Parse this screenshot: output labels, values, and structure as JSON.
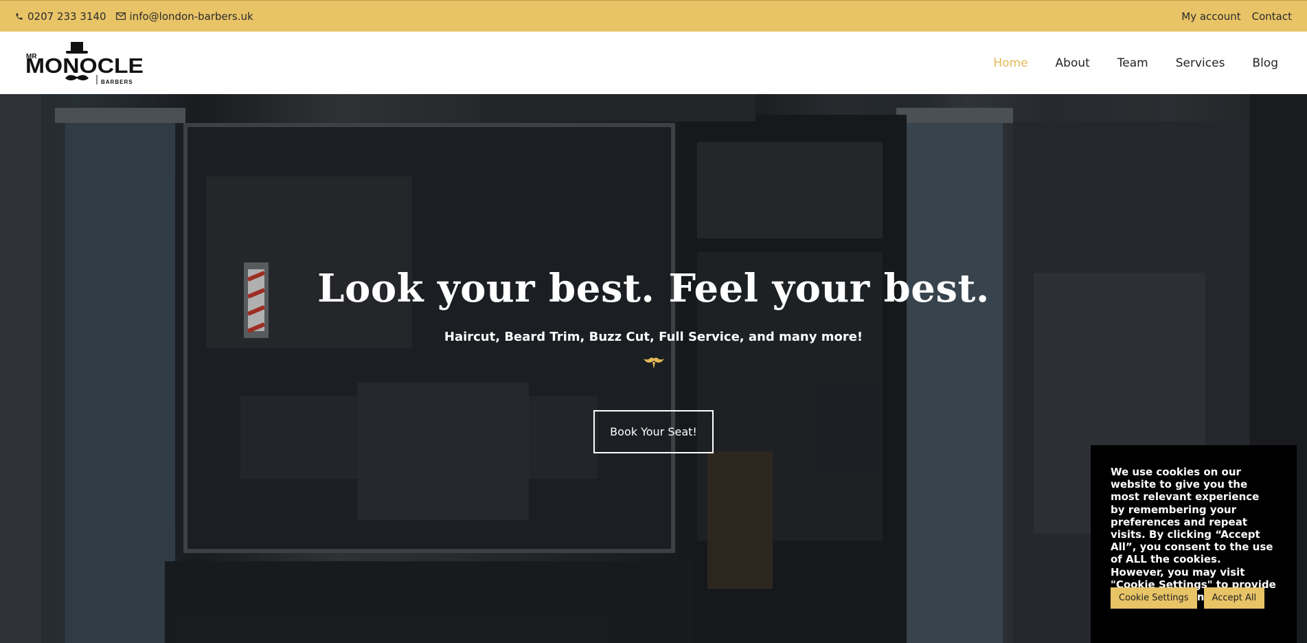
{
  "topbar": {
    "phone": "0207 233 3140",
    "email": "info@london-barbers.uk",
    "links": {
      "account": "My account",
      "contact": "Contact"
    },
    "background": "#e8c467"
  },
  "header": {
    "logo": {
      "line1": "MR",
      "line2": "MONOCLE",
      "line3": "BARBERS"
    },
    "nav": {
      "home": "Home",
      "about": "About",
      "team": "Team",
      "services": "Services",
      "blog": "Blog"
    },
    "accent": "#e3b856"
  },
  "hero": {
    "title": "Look your best. Feel your best.",
    "subtitle": "Haircut, Beard Trim, Buzz Cut, Full Service, and many more!",
    "cta": "Book Your Seat!"
  },
  "cookie": {
    "text": "We use cookies on our website to give you the most relevant experience by remembering your preferences and repeat visits. By clicking “Accept All”, you consent to the use of ALL the cookies. However, you may visit \"Cookie Settings\" to provide a controlled consent.",
    "settings_label": "Cookie Settings",
    "accept_label": "Accept All"
  }
}
